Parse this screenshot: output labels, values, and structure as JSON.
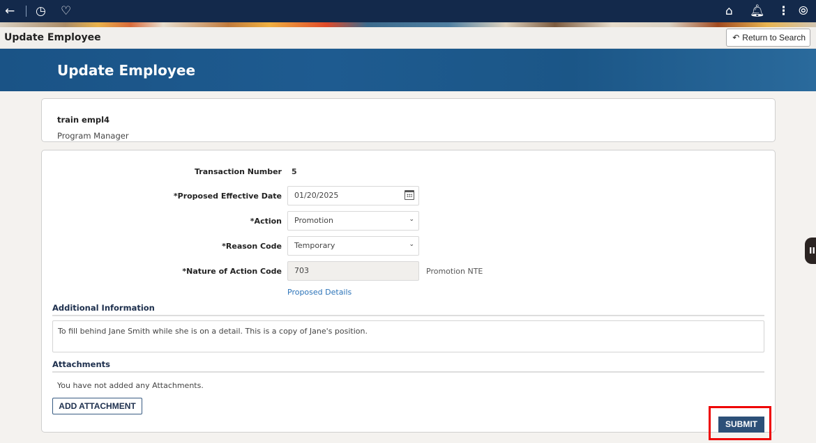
{
  "topnav": {
    "icons_left": [
      "back-arrow",
      "history",
      "favorites"
    ],
    "icons_right": [
      "home",
      "notifications",
      "more-actions",
      "navigator"
    ]
  },
  "titlebar": {
    "title": "Update Employee",
    "return_label": "Return to Search"
  },
  "banner": {
    "title": "Update Employee"
  },
  "employee": {
    "name": "train empl4",
    "title": "Program Manager"
  },
  "form": {
    "transaction_number": {
      "label": "Transaction Number",
      "value": "5"
    },
    "effective_date": {
      "label": "*Proposed Effective Date",
      "value": "01/20/2025"
    },
    "action": {
      "label": "*Action",
      "value": "Promotion"
    },
    "reason_code": {
      "label": "*Reason Code",
      "value": "Temporary"
    },
    "nature_of_action": {
      "label": "*Nature of Action Code",
      "value": "703",
      "description": "Promotion NTE"
    },
    "proposed_details_link": "Proposed Details"
  },
  "additional_info": {
    "heading": "Additional Information",
    "text": "To fill behind Jane Smith while she is on a detail. This is a copy of Jane's position."
  },
  "attachments": {
    "heading": "Attachments",
    "empty_message": "You have not added any Attachments.",
    "add_label": "ADD ATTACHMENT"
  },
  "actions": {
    "submit_label": "SUBMIT"
  },
  "side_tab": {
    "label": "II"
  },
  "colors": {
    "nav": "#13294b",
    "banner": "#1e5b90",
    "submit": "#2d5078",
    "highlight": "#ee0000",
    "link": "#2b73b8"
  }
}
